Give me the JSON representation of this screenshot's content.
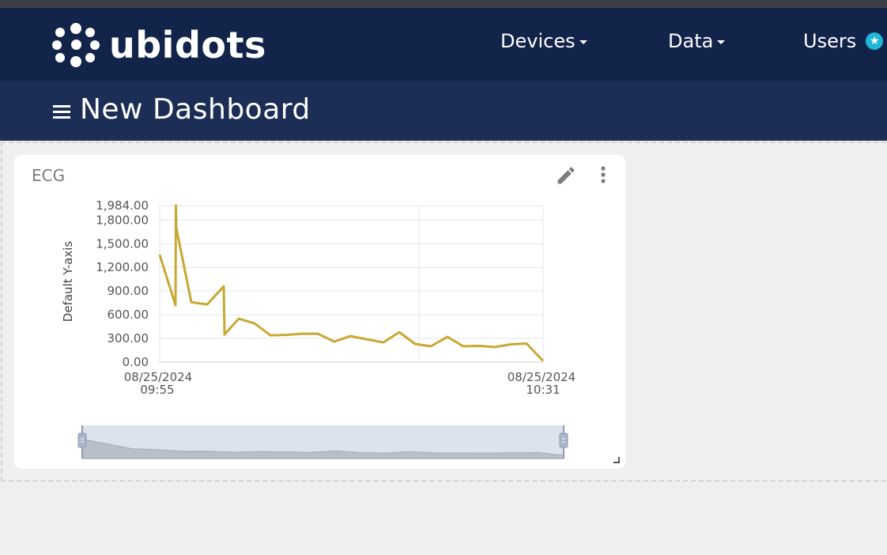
{
  "app": {
    "brand": "ubidots",
    "nav": [
      {
        "label": "Devices",
        "dropdown": true
      },
      {
        "label": "Data",
        "dropdown": true
      },
      {
        "label": "Users",
        "badge_icon": "star-icon"
      }
    ],
    "accent_color": "#1fb6d8",
    "navbar_color": "#13244a",
    "subbar_color": "#1c2d56"
  },
  "dashboard": {
    "title": "New Dashboard"
  },
  "widget": {
    "title": "ECG",
    "line_color": "#c8a832"
  },
  "chart_data": {
    "type": "line",
    "ylabel": "Default Y-axis",
    "ylim": [
      0,
      1984
    ],
    "yticks": [
      "0.00",
      "300.00",
      "600.00",
      "900.00",
      "1,200.00",
      "1,500.00",
      "1,800.00",
      "1,984.00"
    ],
    "ytick_values": [
      0,
      300,
      600,
      900,
      1200,
      1500,
      1800,
      1984
    ],
    "xticks": [
      {
        "date": "08/25/2024",
        "time": "09:55"
      },
      {
        "date": "08/25/2024",
        "time": "10:31"
      }
    ],
    "grid": true,
    "series": [
      {
        "values": [
          1360,
          720,
          1984,
          1700,
          760,
          730,
          960,
          350,
          550,
          490,
          340,
          345,
          360,
          360,
          260,
          330,
          290,
          250,
          380,
          230,
          200,
          320,
          200,
          205,
          190,
          225,
          235,
          15
        ]
      }
    ],
    "navigator_values": [
      1360,
      960,
      550,
      490,
      345,
      360,
      260,
      330,
      290,
      250,
      380,
      230,
      200,
      320,
      200,
      205,
      190,
      225,
      235,
      15
    ]
  }
}
